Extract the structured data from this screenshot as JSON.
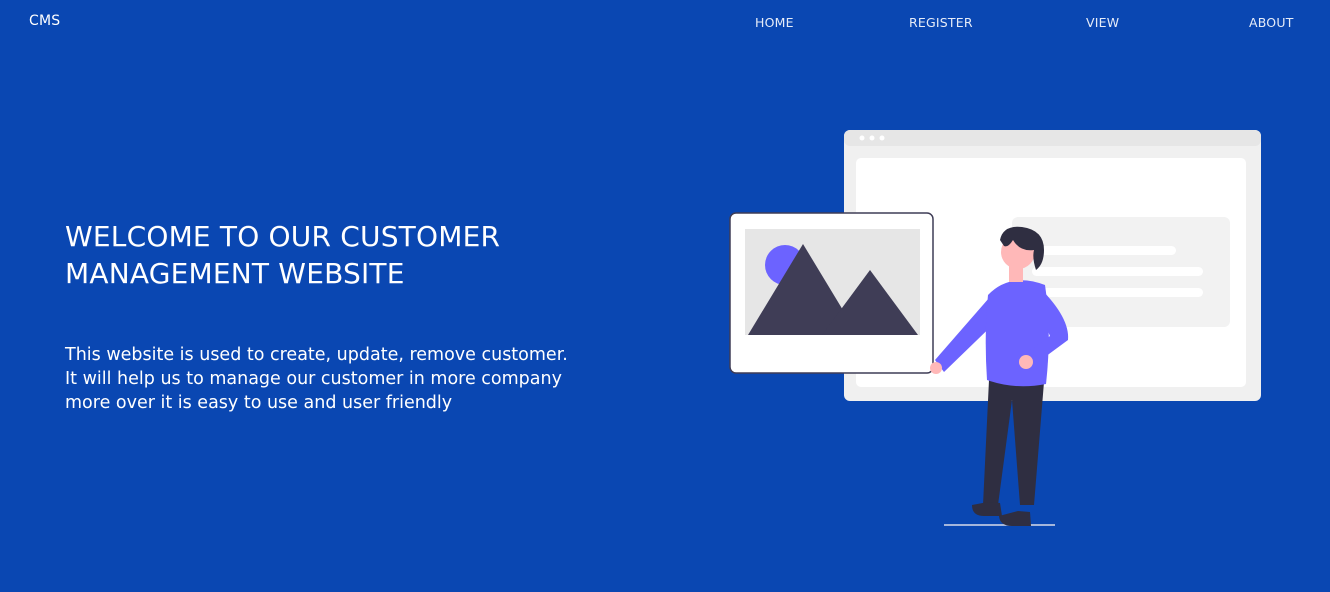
{
  "navbar": {
    "brand": "CMS",
    "links": [
      {
        "label": "HOME"
      },
      {
        "label": "REGISTER"
      },
      {
        "label": "VIEW"
      },
      {
        "label": "ABOUT"
      }
    ]
  },
  "hero": {
    "title_line1": "WELCOME TO OUR CUSTOMER",
    "title_line2": "MANAGEMENT WEBSITE",
    "description_lines": [
      "This website is used to create, update, remove customer.",
      "It will help us to manage our customer in more company",
      "more over it is easy to use and user friendly"
    ]
  },
  "theme": {
    "background": "#0a47b2",
    "accent_purple": "#6c63ff",
    "dark": "#3f3d56"
  },
  "illustration": {
    "icon": "person-presenting-image-illustration"
  }
}
